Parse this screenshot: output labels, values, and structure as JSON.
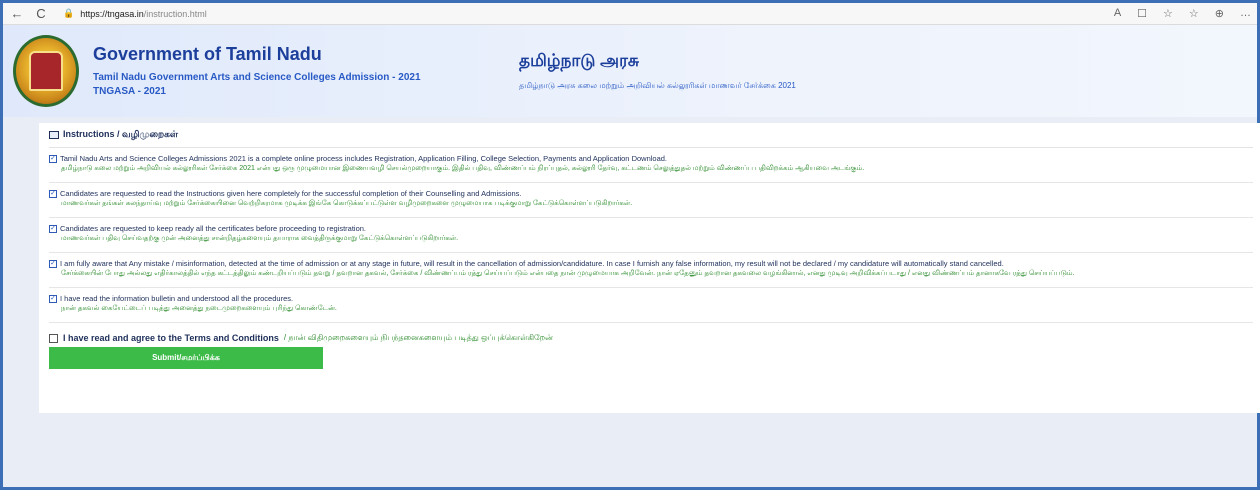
{
  "browser": {
    "back": "←",
    "reload": "C",
    "lock": "🔒",
    "url_host": "https://tngasa.in",
    "url_path": "/instruction.html",
    "toolbar_icons": [
      "A",
      "☐",
      "☆",
      "☆",
      "⊕",
      "…"
    ]
  },
  "header": {
    "title_en": "Government of Tamil Nadu",
    "sub_en_1": "Tamil Nadu Government Arts and Science Colleges Admission - 2021",
    "sub_en_2": "TNGASA - 2021",
    "title_ta": "தமிழ்நாடு அரசு",
    "sub_ta": "தமிழ்நாடு அரசு கலை மற்றும் அறிவியல் கல்லூரிகள் மாணவர் சேர்க்கை 2021"
  },
  "instructions": {
    "section_title": "Instructions / வழிமுறைகள்",
    "items": [
      {
        "en": "Tamil Nadu Arts and Science Colleges Admissions 2021 is a complete online process includes Registration, Application Filling, College Selection, Payments and Application Download.",
        "ta": "தமிழ்நாடு கலை மற்றும் அறிவியல் கல்லூரிகள் சேர்க்கை 2021 என்பது ஒரு முழுமையான இணையவழி செயல்முறையாகும். இதில் பதிவு, விண்ணப்பம் நிரப்புதல், கல்லூரி தேர்வு, கட்டணம் செலுத்துதல் மற்றும் விண்ணப்ப பதிவிறக்கம் ஆகியவை அடங்கும்."
      },
      {
        "en": "Candidates are requested to read the Instructions given here completely for the successful completion of their Counselling and Admissions.",
        "ta": "மாணவர்கள் தங்கள் கலந்தாய்வு மற்றும் சேர்க்கையினை வெற்றிகரமாக முடிக்க இங்கே கொடுக்கப்பட்டுள்ள வழிமுறைகளை முழுமையாக படிக்குமாறு கேட்டுக்கொள்ளப்படுகிறார்கள்."
      },
      {
        "en": "Candidates are requested to keep ready all the certificates before proceeding to registration.",
        "ta": "மாணவர்கள் பதிவு செய்வதற்கு முன் அனைத்து சான்றிதழ்களையும் தயாராக வைத்திருக்குமாறு கேட்டுக்கொள்ளப்படுகிறார்கள்."
      },
      {
        "en": "I am fully aware that Any mistake / misinformation, detected at the time of admission or at any stage in future, will result in the cancellation of admission/candidature. In case I furnish any false information, my result will not be declared / my candidature will automatically stand cancelled.",
        "ta": "சேர்க்கையின் போது அல்லது எதிர்காலத்தில் எந்த கட்டத்திலும் கண்டறியப்படும் தவறு / தவறான தகவல், சேர்க்கை / விண்ணப்பம் ரத்து செய்யப்படும் என்பதை நான் முழுமையாக அறிவேன். நான் ஏதேனும் தவறான தகவலை வழங்கினால், எனது முடிவு அறிவிக்கப்படாது / எனது விண்ணப்பம் தானாகவே ரத்து செய்யப்படும்."
      },
      {
        "en": "I have read the information bulletin and understood all the procedures.",
        "ta": "நான் தகவல் கையேட்டைப் படித்து அனைத்து நடைமுறைகளையும் புரிந்து கொண்டேன்."
      }
    ]
  },
  "agree": {
    "label_en": "I have read and agree to the Terms and Conditions",
    "label_ta": "/ நான் விதிமுறைகளையும் நிபந்தனைகளையும் படித்து ஒப்புக்கொள்கிறேன்"
  },
  "submit": {
    "label": "Submit/சமர்ப்பிக்க"
  },
  "colors": {
    "accent": "#3dbb48",
    "heading": "#1d3f9c",
    "tamil_text": "#2a8a2a"
  }
}
